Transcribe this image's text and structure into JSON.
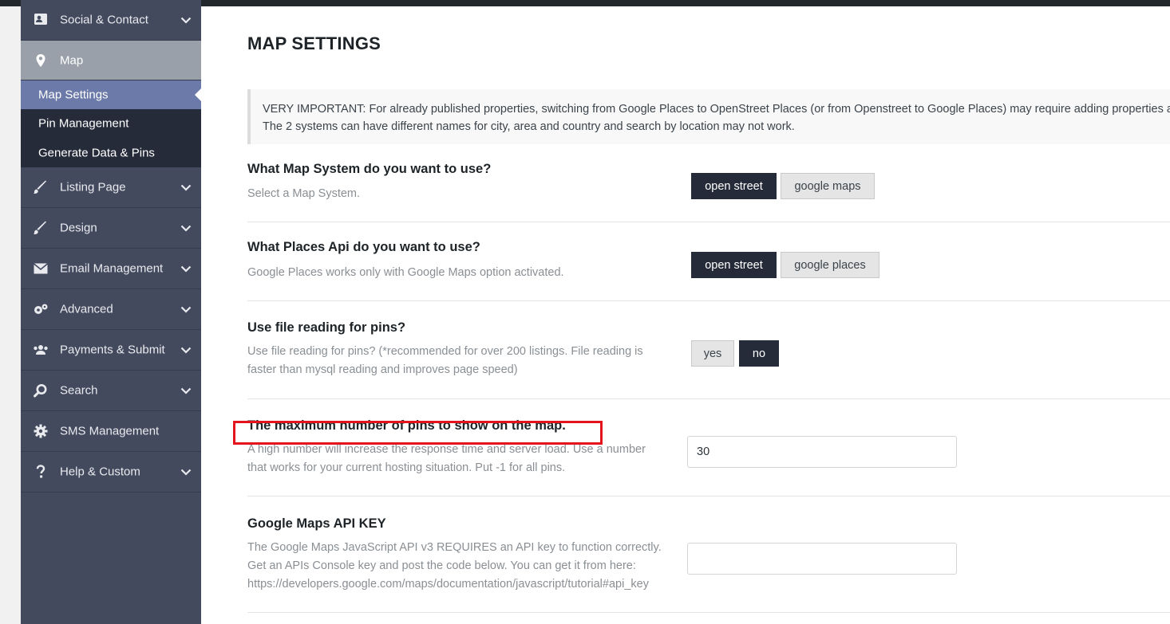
{
  "sidebar": {
    "items": [
      {
        "label": "Social & Contact",
        "icon": "contact-card-icon"
      },
      {
        "label": "Map",
        "icon": "map-pin-icon"
      },
      {
        "label": "Listing Page",
        "icon": "brush-icon"
      },
      {
        "label": "Design",
        "icon": "brush-icon"
      },
      {
        "label": "Email Management",
        "icon": "envelope-icon"
      },
      {
        "label": "Advanced",
        "icon": "gears-icon"
      },
      {
        "label": "Payments & Submit",
        "icon": "users-icon"
      },
      {
        "label": "Search",
        "icon": "search-icon"
      },
      {
        "label": "SMS Management",
        "icon": "gear-icon"
      },
      {
        "label": "Help & Custom",
        "icon": "question-icon"
      }
    ],
    "subitems": [
      {
        "label": "Map Settings"
      },
      {
        "label": "Pin Management"
      },
      {
        "label": "Generate Data & Pins"
      }
    ]
  },
  "main": {
    "title": "MAP SETTINGS",
    "notice": "VERY IMPORTANT: For already published properties, switching from Google Places to OpenStreet Places (or from Openstreet to Google Places) may require adding properties again. The 2 systems can have different names for city, area and country and search by location may not work.",
    "settings": [
      {
        "title": "What Map System do you want to use?",
        "desc": "Select a Map System.",
        "options": [
          "open street",
          "google maps"
        ],
        "selected": "open street"
      },
      {
        "title": "What Places Api do you want to use?",
        "desc": "Google Places works only with Google Maps option activated.",
        "options": [
          "open street",
          "google places"
        ],
        "selected": "open street"
      },
      {
        "title": "Use file reading for pins?",
        "desc": "Use file reading for pins? (*recommended for over 200 listings. File reading is faster than mysql reading and improves page speed)",
        "options": [
          "yes",
          "no"
        ],
        "selected": "no"
      },
      {
        "title": "The maximum number of pins to show on the map.",
        "desc": "A high number will increase the response time and server load. Use a number that works for your current hosting situation. Put -1 for all pins.",
        "value": "30"
      },
      {
        "title": "Google Maps API KEY",
        "desc": "The Google Maps JavaScript API v3 REQUIRES an API key to function correctly. Get an APIs Console key and post the code below. You can get it from here: https://developers.google.com/maps/documentation/javascript/tutorial#api_key",
        "value": ""
      }
    ]
  },
  "colors": {
    "sidebar_bg": "#434a5e",
    "submenu_bg": "#262b3a",
    "active_sub": "#6b7aa8",
    "active_item": "#9aa0a9",
    "highlight_box": "#e3141b"
  }
}
